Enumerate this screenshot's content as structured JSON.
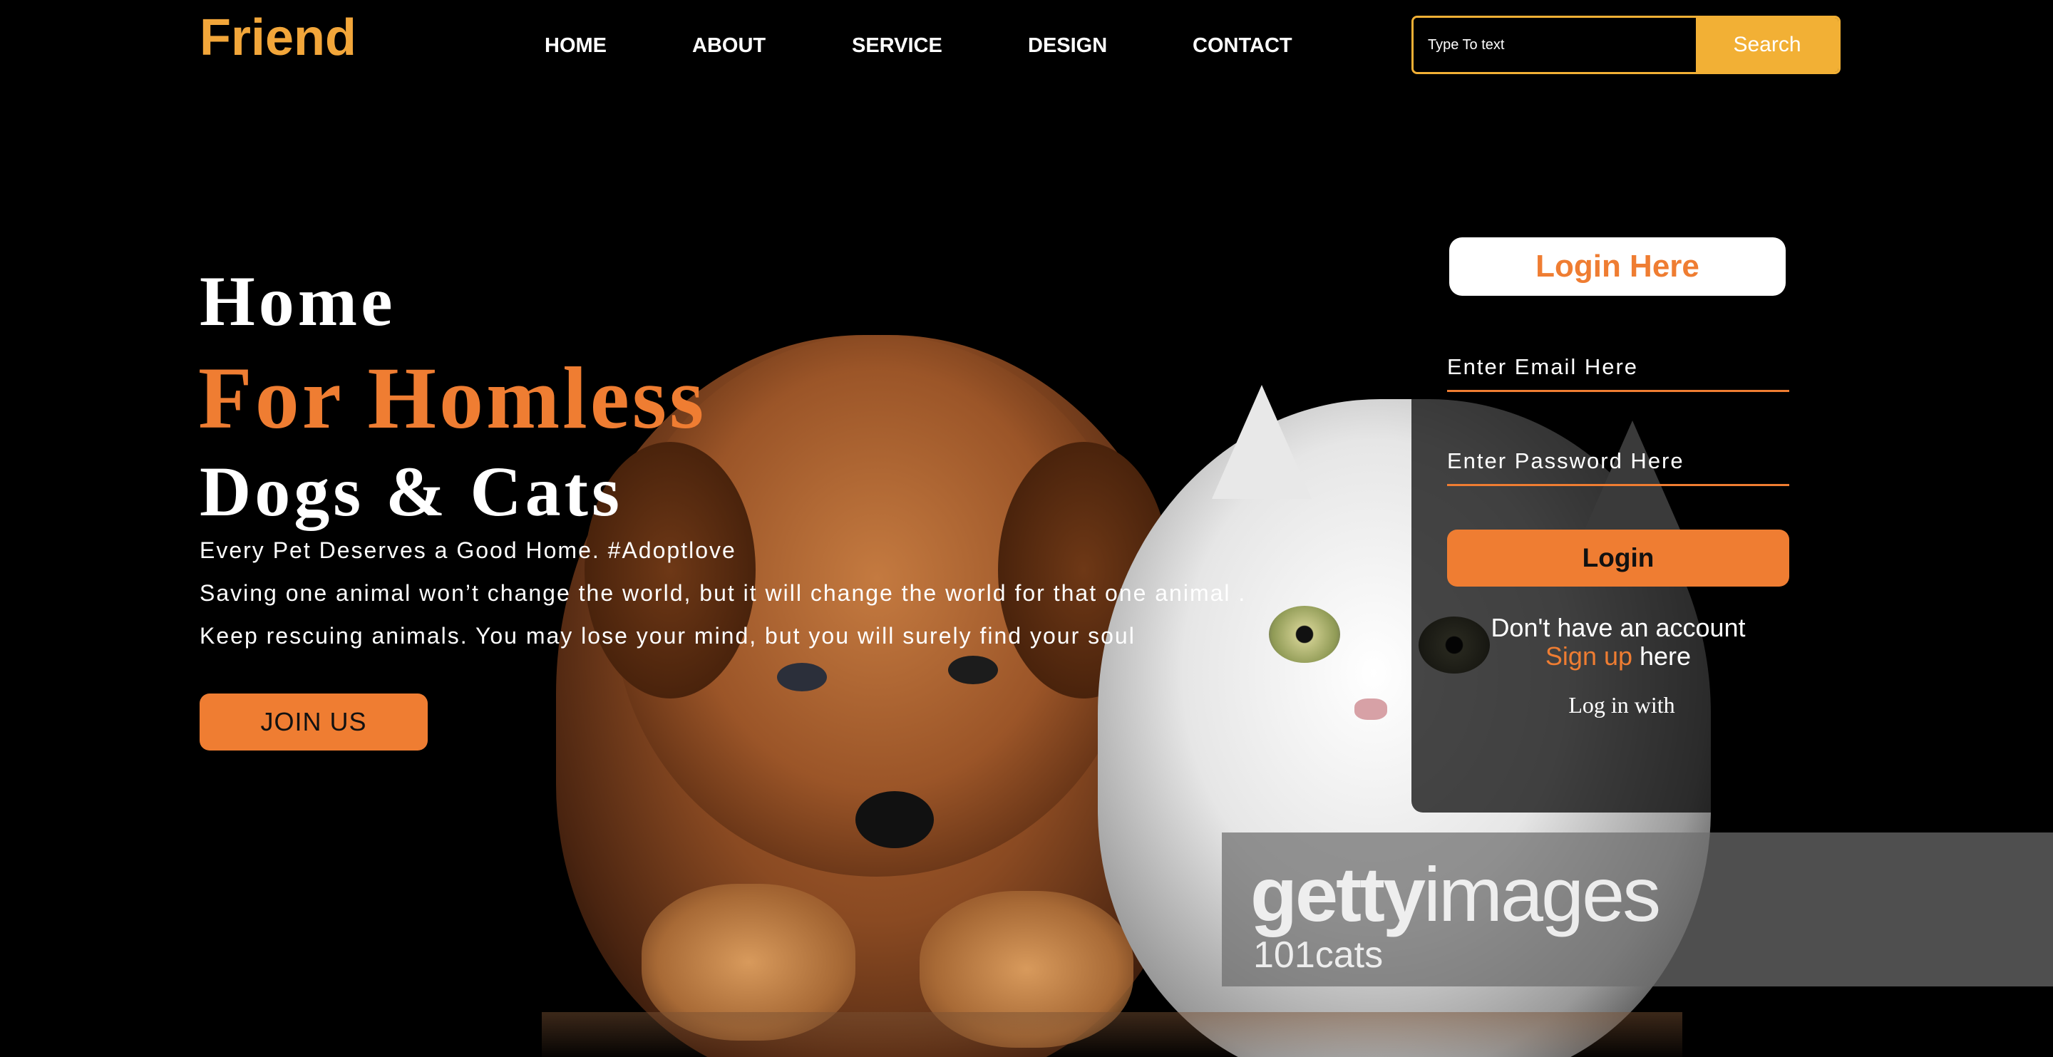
{
  "brand": {
    "logo": "Friend"
  },
  "nav": {
    "items": [
      {
        "label": "HOME"
      },
      {
        "label": "ABOUT"
      },
      {
        "label": "SERVICE"
      },
      {
        "label": "DESIGN"
      },
      {
        "label": "CONTACT"
      }
    ]
  },
  "search": {
    "placeholder": "Type To text",
    "button_label": "Search"
  },
  "hero": {
    "line1": "Home",
    "line2": "For Homless",
    "line3": "Dogs & Cats",
    "taglines": [
      "Every Pet Deserves a Good Home. #Adoptlove",
      "Saving one animal won’t change the world, but it will change the world for that one animal .",
      "Keep rescuing animals. You may lose your mind, but you will surely find your soul"
    ],
    "cta_label": "JOIN US"
  },
  "login": {
    "title": "Login Here",
    "email_placeholder": "Enter Email Here",
    "password_placeholder": "Enter Password Here",
    "button_label": "Login",
    "no_account_text": "Don't have an account",
    "signup_link": "Sign up",
    "signup_suffix": " here",
    "login_with": "Log in with"
  },
  "watermark": {
    "brand_bold": "getty",
    "brand_light": "images",
    "sub": "101cats"
  },
  "colors": {
    "accent": "#ef7d32",
    "logo": "#f2a63a",
    "search_accent": "#f2b035",
    "background": "#000000"
  }
}
